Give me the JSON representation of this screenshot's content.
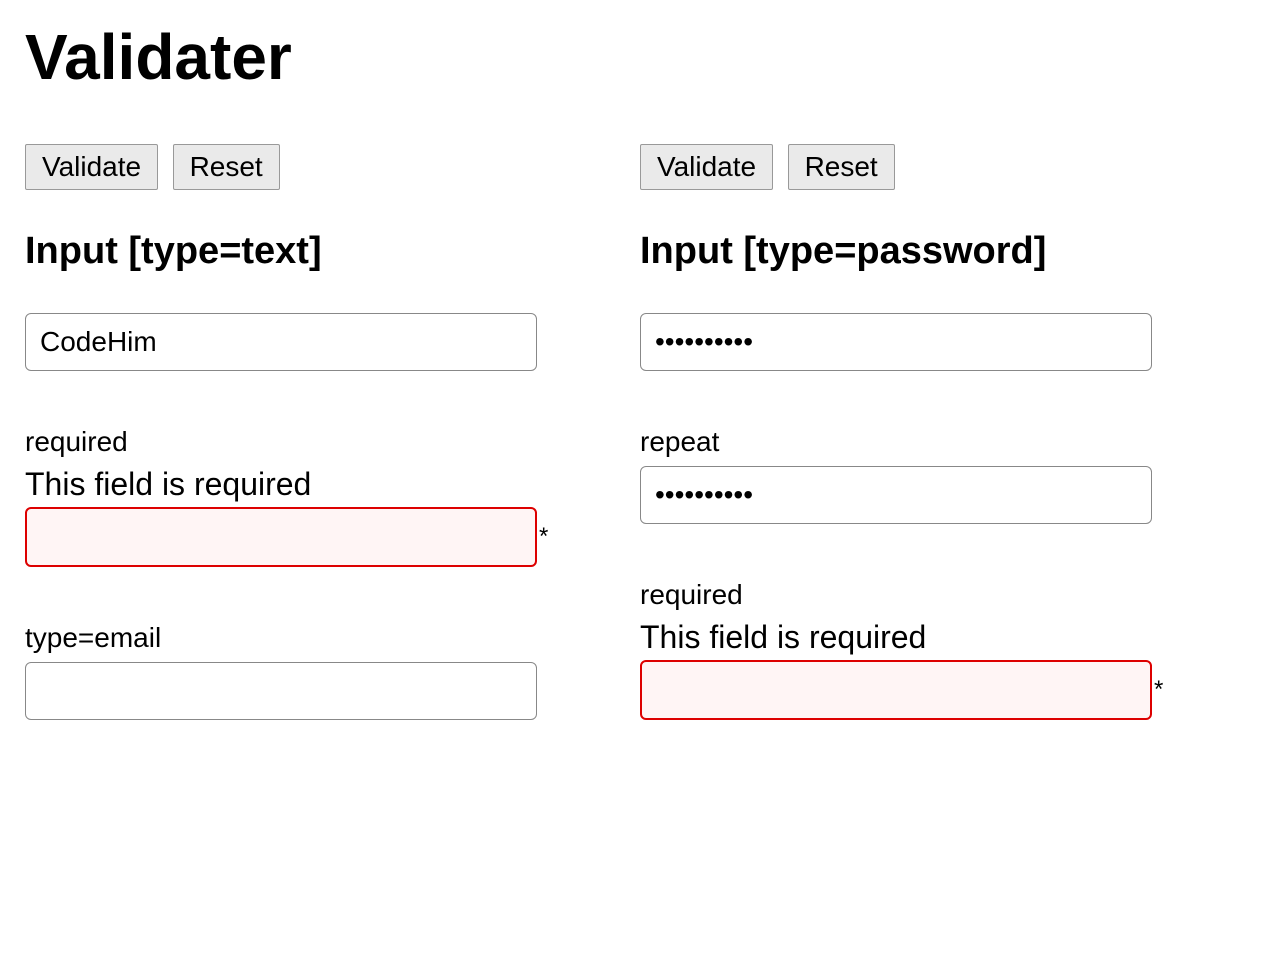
{
  "page": {
    "title": "Validater"
  },
  "buttons": {
    "validate": "Validate",
    "reset": "Reset"
  },
  "left": {
    "heading": "Input [type=text]",
    "field1": {
      "value": "CodeHim"
    },
    "field2": {
      "label": "required",
      "error": "This field is required",
      "star": "*",
      "value": ""
    },
    "field3": {
      "label": "type=email",
      "value": ""
    }
  },
  "right": {
    "heading": "Input [type=password]",
    "field1": {
      "value": "••••••••••"
    },
    "field2": {
      "label": "repeat",
      "value": "••••••••••"
    },
    "field3": {
      "label": "required",
      "error": "This field is required",
      "star": "*",
      "value": ""
    }
  }
}
